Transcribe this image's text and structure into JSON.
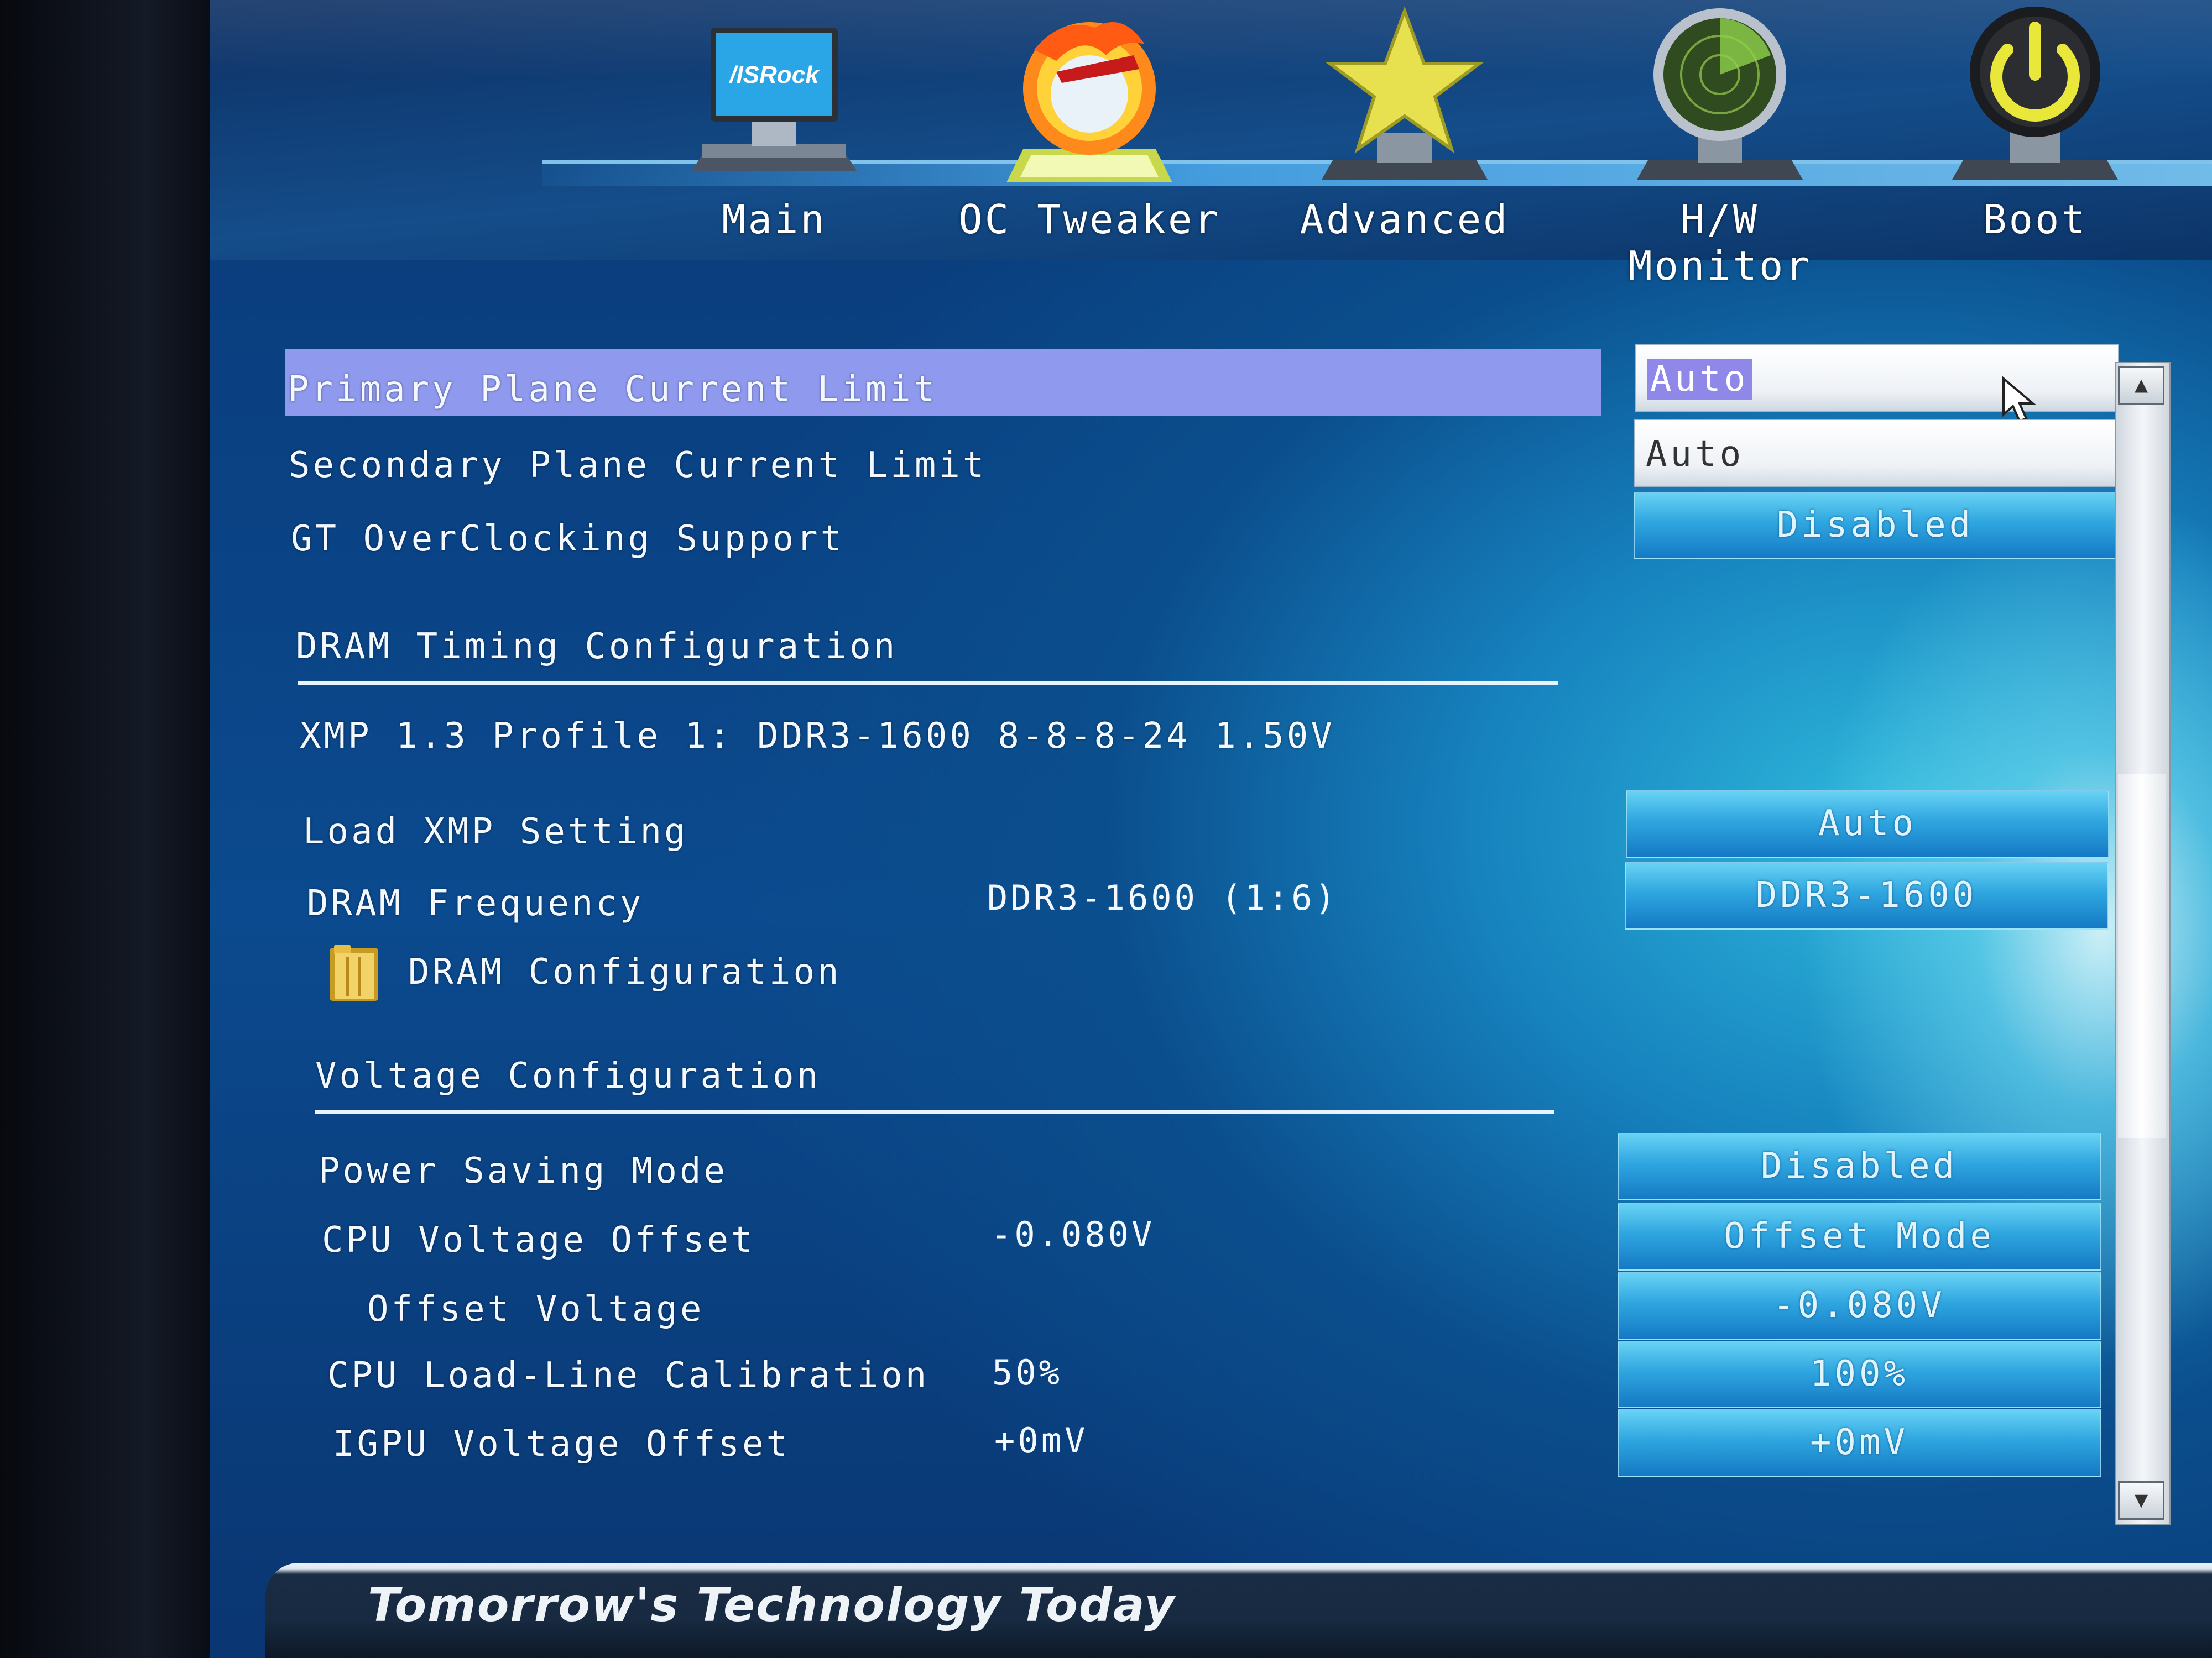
{
  "nav": {
    "brand_text": "/ISRock",
    "items": [
      {
        "label": "Main",
        "icon": "asrock-monitor-icon"
      },
      {
        "label": "OC Tweaker",
        "icon": "flame-gauge-icon"
      },
      {
        "label": "Advanced",
        "icon": "star-icon"
      },
      {
        "label": "H/W Monitor",
        "icon": "radar-icon"
      },
      {
        "label": "Boot",
        "icon": "power-icon"
      }
    ]
  },
  "settings": {
    "primary_plane_current_limit": {
      "label": "Primary Plane Current Limit",
      "value": "Auto"
    },
    "secondary_plane_current_limit": {
      "label": "Secondary Plane Current Limit",
      "value": "Auto"
    },
    "gt_overclocking_support": {
      "label": "GT OverClocking Support",
      "value": "Disabled"
    },
    "dram_section": {
      "title": "DRAM Timing Configuration"
    },
    "xmp_profile": {
      "text": "XMP 1.3 Profile 1: DDR3-1600 8-8-8-24 1.50V"
    },
    "load_xmp_setting": {
      "label": "Load XMP Setting",
      "value": "Auto"
    },
    "dram_frequency": {
      "label": "DRAM Frequency",
      "current": "DDR3-1600 (1:6)",
      "value": "DDR3-1600"
    },
    "dram_configuration": {
      "label": "DRAM Configuration"
    },
    "voltage_section": {
      "title": "Voltage Configuration"
    },
    "power_saving_mode": {
      "label": "Power Saving Mode",
      "value": "Disabled"
    },
    "cpu_voltage_offset": {
      "label": "CPU Voltage Offset",
      "current": "-0.080V",
      "value": "Offset Mode"
    },
    "offset_voltage": {
      "label": "Offset Voltage",
      "value": "-0.080V"
    },
    "cpu_llc": {
      "label": "CPU Load-Line Calibration",
      "current": "50%",
      "value": "100%"
    },
    "igpu_voltage_offset": {
      "label": "IGPU Voltage Offset",
      "current": "+0mV",
      "value": "+0mV"
    }
  },
  "scrollbar": {
    "up_icon": "scroll-up-arrow-icon",
    "down_icon": "scroll-down-arrow-icon"
  },
  "footer": {
    "tagline": "Tomorrow's Technology Today"
  },
  "colors": {
    "highlight": "#8f99ee",
    "button": "#2fa6e0",
    "background": "#0b4a8e"
  }
}
